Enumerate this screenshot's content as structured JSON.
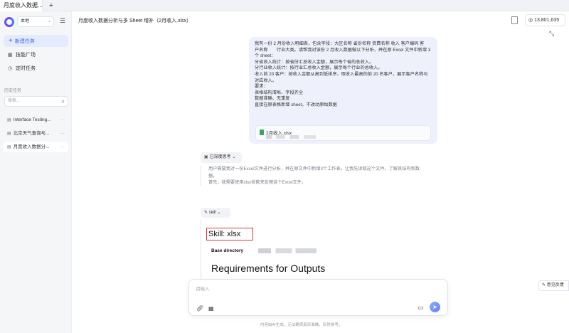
{
  "browser": {
    "tab_title": "月度收入数据...",
    "new_tab_symbol": "+"
  },
  "sidebar": {
    "workspace": "本地",
    "new_task": "新建任务",
    "nav": [
      {
        "icon": "grid-icon",
        "label": "技能广场"
      },
      {
        "icon": "clock-icon",
        "label": "定时任务"
      }
    ],
    "history_label": "历史任务",
    "search_placeholder": "搜索...",
    "history": [
      {
        "label": "Interface Testing..."
      },
      {
        "label": "北京天气查询与..."
      },
      {
        "label": "月度收入数据分..."
      }
    ]
  },
  "header": {
    "title": "月度收入数据分析与多 Sheet 增补（2月收入.xlsx）",
    "credits": "13,801,635"
  },
  "message": {
    "lines": [
      "我有一份 2 月份收入明细表，包含字段：大区名称 省份名称 资费名称 收入 客户编码 客",
      "户名称　　行业大类。请帮我对该份 2 月收入数据做以下分析，并在原 Excel 文件中新增 3",
      "个 sheet：",
      "分省收入统计：按省份汇总收入金额，展示每个省的总收入。",
      "分行业收入统计：按行业汇总收入金额，展示每个行业的总收入。",
      "收入前 20 客户：按收入金额从高到低排序，取收入最高的前 20 名客户，展示客户名称与",
      "对应收入。",
      "要求：",
      "表格结构清晰、字段齐全",
      "数据准确、无重复",
      "直接在原表格新增 sheet，不改动原始数据"
    ],
    "file_name": "2月收入.xlsx"
  },
  "thinking": {
    "badge": "已深度思考",
    "lines": [
      "用户需要我对一份Excel文件进行分析，并在原文件中新增3个工作表。让我先读取这个文件，了解其结构和数",
      "据。",
      "首先，我需要使用xlsx技能来处理这个Excel文件。"
    ]
  },
  "skill": {
    "chip": "skill",
    "title": "Skill: xlsx",
    "base_dir_label": "Base directory",
    "heading": "Requirements for Outputs"
  },
  "input": {
    "placeholder": "请输入"
  },
  "footer_note": "内容由AI生成，无法确保真实准确，仅供参考。",
  "feedback": "意见反馈",
  "colors": {
    "accent": "#3a62e6",
    "highlight_box": "#d83a3a",
    "bubble_bg": "#eef0fb"
  }
}
